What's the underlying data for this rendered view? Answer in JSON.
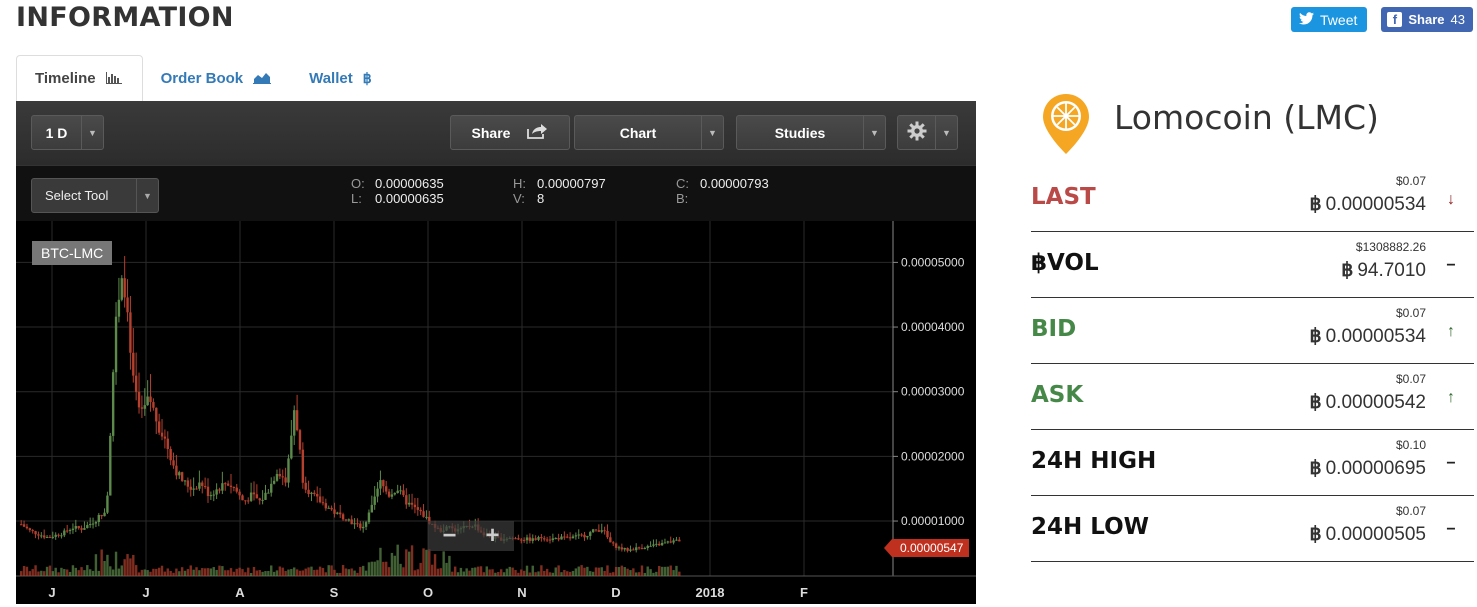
{
  "page_title": "INFORMATION",
  "social": {
    "tweet_label": "Tweet",
    "share_label": "Share",
    "share_count": "43"
  },
  "tabs": [
    {
      "label": "Timeline",
      "icon": "bar-chart-icon",
      "active": true
    },
    {
      "label": "Order Book",
      "icon": "area-chart-icon",
      "active": false
    },
    {
      "label": "Wallet",
      "icon": "bitcoin-icon",
      "active": false
    }
  ],
  "chart": {
    "interval_label": "1 D",
    "share_label": "Share",
    "chart_label": "Chart",
    "studies_label": "Studies",
    "select_tool_label": "Select Tool",
    "ohlc": {
      "o": "0.00000635",
      "h": "0.00000797",
      "c": "0.00000793",
      "l": "0.00000635",
      "v": "8",
      "b": ""
    },
    "symbol": "BTC-LMC",
    "last_price_tag": "0.00000547",
    "colors": {
      "up": "#5c8a4a",
      "down": "#b5402e",
      "grid": "#2a2a2a"
    }
  },
  "chart_data": {
    "type": "candlestick",
    "x_ticks": [
      "J",
      "J",
      "A",
      "S",
      "O",
      "N",
      "D",
      "2018",
      "F"
    ],
    "y_ticks": [
      "0.00001000",
      "0.00002000",
      "0.00003000",
      "0.00004000",
      "0.00005000"
    ],
    "ylim": [
      1.5e-06,
      5.64e-05
    ],
    "grid": true,
    "close_series": [
      9.5e-06,
      8.5e-06,
      8e-06,
      7.5e-06,
      7.8e-06,
      8.2e-06,
      9e-06,
      8.8e-06,
      9.5e-06,
      1.05e-05,
      1.2e-05,
      4e-05,
      4.8e-05,
      3.2e-05,
      2.6e-05,
      2.9e-05,
      2.5e-05,
      2.2e-05,
      1.8e-05,
      1.6e-05,
      1.5e-05,
      1.6e-05,
      1.4e-05,
      1.5e-05,
      1.6e-05,
      1.5e-05,
      1.3e-05,
      1.4e-05,
      1.3e-05,
      1.5e-05,
      1.8e-05,
      1.6e-05,
      2.8e-05,
      1.6e-05,
      1.4e-05,
      1.3e-05,
      1.2e-05,
      1.1e-05,
      1.05e-05,
      9.5e-06,
      9e-06,
      1.2e-05,
      1.6e-05,
      1.4e-05,
      1.5e-05,
      1.3e-05,
      1.2e-05,
      1.1e-05,
      9.5e-06,
      8.5e-06,
      9e-06,
      8.5e-06,
      9e-06,
      9.5e-06,
      8e-06,
      7.5e-06,
      7.2e-06,
      7.4e-06,
      7.3e-06,
      7.2e-06,
      7.1e-06,
      7.5e-06,
      7.2e-06,
      7.4e-06,
      7.3e-06,
      7.6e-06,
      7.8e-06,
      8.5e-06,
      8.8e-06,
      6.5e-06,
      5.8e-06,
      5.5e-06,
      5.8e-06,
      6e-06,
      6.2e-06,
      6.5e-06,
      6.8e-06,
      7e-06
    ]
  },
  "coin": {
    "name": "Lomocoin (LMC)",
    "rows": [
      {
        "label": "LAST",
        "usd": "$0.07",
        "btc": "0.00000534",
        "trend": "down",
        "color": "red"
      },
      {
        "label": "฿VOL",
        "usd": "$1308882.26",
        "btc": "94.7010",
        "trend": "flat",
        "color": "black"
      },
      {
        "label": "BID",
        "usd": "$0.07",
        "btc": "0.00000534",
        "trend": "up",
        "color": "green"
      },
      {
        "label": "ASK",
        "usd": "$0.07",
        "btc": "0.00000542",
        "trend": "up",
        "color": "green"
      },
      {
        "label": "24H HIGH",
        "usd": "$0.10",
        "btc": "0.00000695",
        "trend": "flat",
        "color": "black"
      },
      {
        "label": "24H LOW",
        "usd": "$0.07",
        "btc": "0.00000505",
        "trend": "flat",
        "color": "black"
      }
    ]
  }
}
